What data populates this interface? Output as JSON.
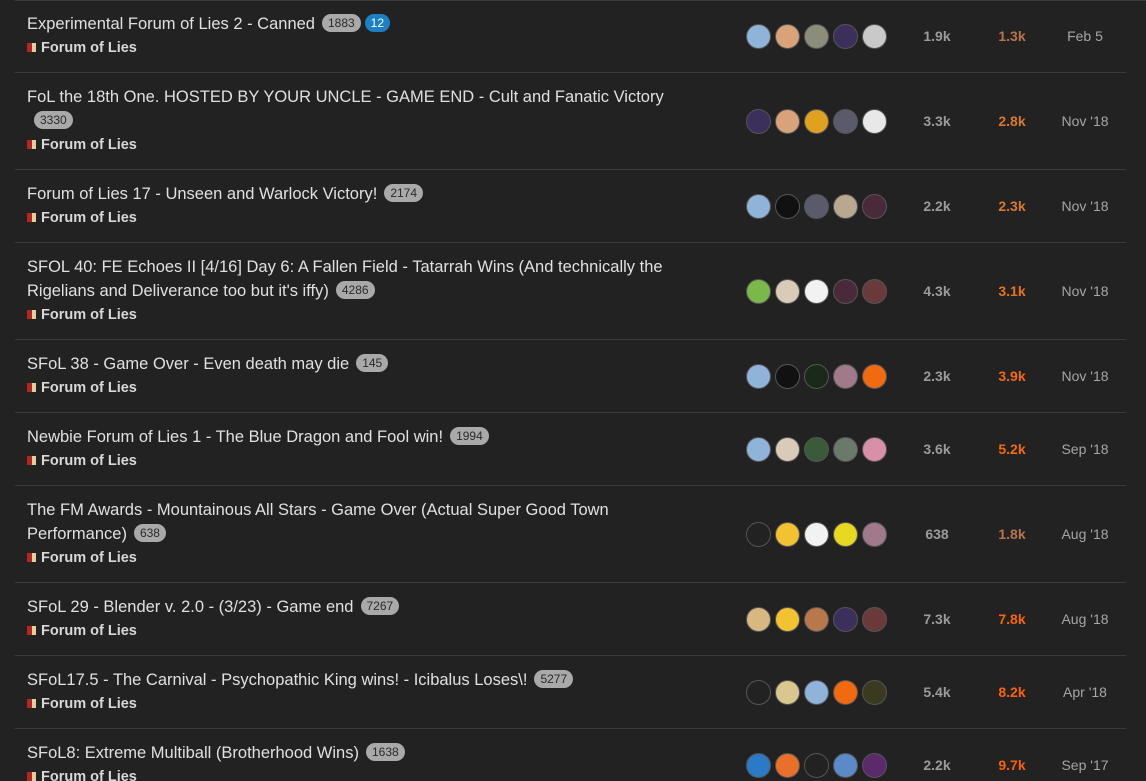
{
  "topics": [
    {
      "title": "Experimental Forum of Lies 2 - Canned",
      "posts": "1883",
      "new_count": "12",
      "category": "Forum of Lies",
      "replies": "1.9k",
      "views": "1.3k",
      "views_color": "#b8744a",
      "activity": "Feb 5",
      "avatars": [
        {
          "name": "blue-face-avatar",
          "color": "#8fb3d9"
        },
        {
          "name": "peach-face-avatar",
          "color": "#d9a37a"
        },
        {
          "name": "goggles-avatar",
          "color": "#8c8c7a"
        },
        {
          "name": "purple-hair-avatar",
          "color": "#3b2f5c"
        },
        {
          "name": "white-hair-avatar",
          "color": "#c9c9c9"
        }
      ]
    },
    {
      "title": "FoL the 18th One. HOSTED BY YOUR UNCLE - GAME END - Cult and Fanatic Victory",
      "posts": "3330",
      "new_count": "",
      "category": "Forum of Lies",
      "replies": "3.3k",
      "views": "2.8k",
      "views_color": "#d9782e",
      "activity": "Nov '18",
      "avatars": [
        {
          "name": "purple-hair-avatar",
          "color": "#3b2f5c"
        },
        {
          "name": "peach-face-avatar",
          "color": "#d9a37a"
        },
        {
          "name": "yellow-cross-avatar",
          "color": "#e0a020"
        },
        {
          "name": "dark-hair-avatar",
          "color": "#5a5a6a"
        },
        {
          "name": "red-white-avatar",
          "color": "#e8e8e8"
        }
      ]
    },
    {
      "title": "Forum of Lies 17 - Unseen and Warlock Victory!",
      "posts": "2174",
      "new_count": "",
      "category": "Forum of Lies",
      "replies": "2.2k",
      "views": "2.3k",
      "views_color": "#d9782e",
      "activity": "Nov '18",
      "avatars": [
        {
          "name": "blue-face-avatar",
          "color": "#8fb3d9"
        },
        {
          "name": "sz-logo-avatar",
          "color": "#111111"
        },
        {
          "name": "dark-hair-avatar",
          "color": "#5a5a6a"
        },
        {
          "name": "bearded-man-avatar",
          "color": "#b8a890"
        },
        {
          "name": "dark-figure-avatar",
          "color": "#4a2a3a"
        }
      ]
    },
    {
      "title": "SFOL 40: FE Echoes II [4/16] Day 6: A Fallen Field - Tatarrah Wins (And technically the Rigelians and Deliverance too but it's iffy)",
      "posts": "4286",
      "new_count": "",
      "category": "Forum of Lies",
      "replies": "4.3k",
      "views": "3.1k",
      "views_color": "#e8731c",
      "activity": "Nov '18",
      "avatars": [
        {
          "name": "green-character-avatar",
          "color": "#7ab84a"
        },
        {
          "name": "beige-sketch-avatar",
          "color": "#d8cbb8"
        },
        {
          "name": "pixel-character-avatar",
          "color": "#f2f2f2"
        },
        {
          "name": "dark-figure-avatar",
          "color": "#4a2a3a"
        },
        {
          "name": "red-dark-avatar",
          "color": "#6a3a3a"
        }
      ]
    },
    {
      "title": "SFoL 38 - Game Over - Even death may die",
      "posts": "145",
      "new_count": "",
      "category": "Forum of Lies",
      "replies": "2.3k",
      "views": "3.9k",
      "views_color": "#f26a10",
      "activity": "Nov '18",
      "avatars": [
        {
          "name": "blue-face-avatar",
          "color": "#8fb3d9"
        },
        {
          "name": "sz-logo-avatar",
          "color": "#111111"
        },
        {
          "name": "green-eye-avatar",
          "color": "#1a2a1a"
        },
        {
          "name": "anime-girls-avatar",
          "color": "#a07a8a"
        },
        {
          "name": "yin-yang-avatar",
          "color": "#f26a10"
        }
      ]
    },
    {
      "title": "Newbie Forum of Lies 1 - The Blue Dragon and Fool win!",
      "posts": "1994",
      "new_count": "",
      "category": "Forum of Lies",
      "replies": "3.6k",
      "views": "5.2k",
      "views_color": "#f56a0a",
      "activity": "Sep '18",
      "avatars": [
        {
          "name": "blue-face-avatar",
          "color": "#8fb3d9"
        },
        {
          "name": "beige-sketch-avatar",
          "color": "#d8cbb8"
        },
        {
          "name": "green-pixel-avatar",
          "color": "#3a5a3a"
        },
        {
          "name": "hooded-figure-avatar",
          "color": "#6a7a6a"
        },
        {
          "name": "pink-jar-avatar",
          "color": "#d890a8"
        }
      ]
    },
    {
      "title": "The FM Awards - Mountainous All Stars - Game Over (Actual Super Good Town Performance)",
      "posts": "638",
      "new_count": "",
      "category": "Forum of Lies",
      "replies": "638",
      "views": "1.8k",
      "views_color": "#b8744a",
      "activity": "Aug '18",
      "avatars": [
        {
          "name": "skeleton-avatar",
          "color": "#222222"
        },
        {
          "name": "laughing-emoji-avatar",
          "color": "#f2c230"
        },
        {
          "name": "pixel-character-avatar",
          "color": "#f2f2f2"
        },
        {
          "name": "radiation-avatar",
          "color": "#e8d820"
        },
        {
          "name": "anime-girls-avatar",
          "color": "#a07a8a"
        }
      ]
    },
    {
      "title": "SFoL 29 - Blender v. 2.0 - (3/23) - Game end",
      "posts": "7267",
      "new_count": "",
      "category": "Forum of Lies",
      "replies": "7.3k",
      "views": "7.8k",
      "views_color": "#f86408",
      "activity": "Aug '18",
      "avatars": [
        {
          "name": "sandwich-avatar",
          "color": "#d8b880"
        },
        {
          "name": "laughing-emoji-avatar",
          "color": "#f2c230"
        },
        {
          "name": "fighter-avatar",
          "color": "#b8784a"
        },
        {
          "name": "purple-hair-avatar",
          "color": "#3b2f5c"
        },
        {
          "name": "red-dark-avatar",
          "color": "#6a3a3a"
        }
      ]
    },
    {
      "title": "SFoL17.5 - The Carnival - Psychopathic King wins! - Icibalus Loses\\!",
      "posts": "5277",
      "new_count": "",
      "category": "Forum of Lies",
      "replies": "5.4k",
      "views": "8.2k",
      "views_color": "#fa6205",
      "activity": "Apr '18",
      "avatars": [
        {
          "name": "skeleton-avatar",
          "color": "#222222"
        },
        {
          "name": "blonde-anime-avatar",
          "color": "#d8c890"
        },
        {
          "name": "blue-face-avatar",
          "color": "#8fb3d9"
        },
        {
          "name": "yin-yang-avatar",
          "color": "#f26a10"
        },
        {
          "name": "dark-olive-avatar",
          "color": "#3a3a20"
        }
      ]
    },
    {
      "title": "SFoL8: Extreme Multiball (Brotherhood Wins)",
      "posts": "1638",
      "new_count": "",
      "category": "Forum of Lies",
      "replies": "2.2k",
      "views": "9.7k",
      "views_color": "#fc6003",
      "activity": "Sep '17",
      "avatars": [
        {
          "name": "blue-hood-avatar",
          "color": "#2a7ac8"
        },
        {
          "name": "orange-ball-avatar",
          "color": "#e8702a"
        },
        {
          "name": "skeleton-avatar",
          "color": "#222222"
        },
        {
          "name": "blue-swirl-avatar",
          "color": "#5a8ac8"
        },
        {
          "name": "purple-pixel-avatar",
          "color": "#5a2a6a"
        }
      ]
    }
  ]
}
